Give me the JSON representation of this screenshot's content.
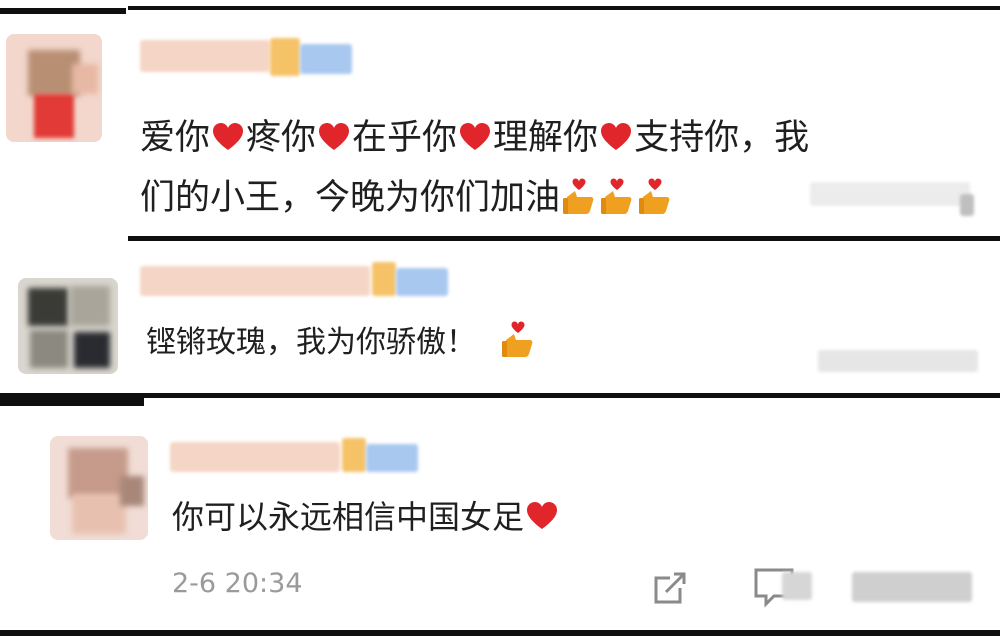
{
  "comments": [
    {
      "segments": [
        "爱你",
        "heart",
        "疼你",
        "heart",
        "在乎你",
        "heart",
        "理解你",
        "heart",
        "支持你，我"
      ],
      "line2": "们的小王，今晚为你们加油",
      "line2_emojis": [
        "thumbs-up-heart",
        "thumbs-up-heart",
        "thumbs-up-heart"
      ]
    },
    {
      "text": "铿锵玫瑰，我为你骄傲！",
      "emojis": [
        "thumbs-up-heart"
      ]
    },
    {
      "text": "你可以永远相信中国女足",
      "emojis": [
        "heart"
      ],
      "timestamp": "2-6 20:34"
    }
  ],
  "colors": {
    "heart": "#e0262b",
    "thumb": "#f0a020",
    "timestamp": "#9a9a9a",
    "divider": "#0f0f0f"
  },
  "icons": [
    "share-icon",
    "comment-icon",
    "thumbs-up-heart-icon",
    "heart-icon"
  ]
}
